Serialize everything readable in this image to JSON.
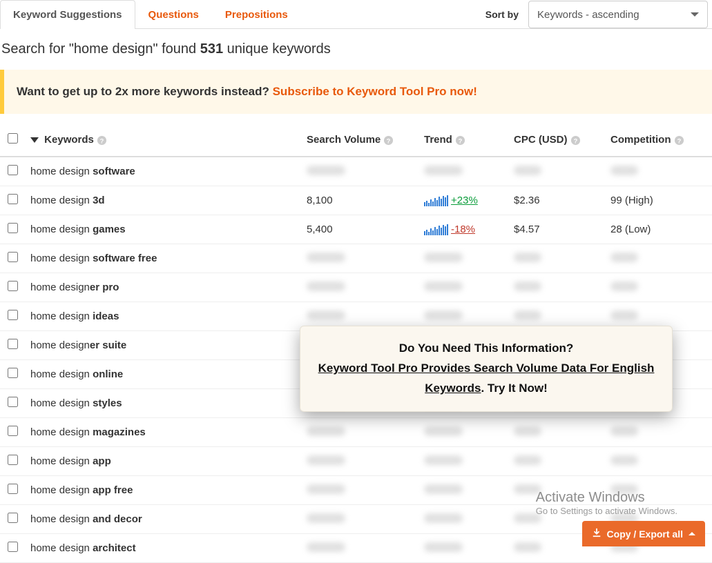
{
  "tabs": {
    "suggestions": "Keyword Suggestions",
    "questions": "Questions",
    "prepositions": "Prepositions"
  },
  "sort": {
    "label": "Sort by",
    "selected": "Keywords - ascending"
  },
  "summary": {
    "prefix": "Search for \"home design\" found ",
    "count": "531",
    "suffix": " unique keywords"
  },
  "promo": {
    "text": "Want to get up to 2x more keywords instead? ",
    "link": "Subscribe to Keyword Tool Pro now!"
  },
  "columns": {
    "keywords": "Keywords",
    "volume": "Search Volume",
    "trend": "Trend",
    "cpc": "CPC (USD)",
    "competition": "Competition"
  },
  "rows": [
    {
      "prefix": "home design ",
      "bold": "software",
      "blurred": true
    },
    {
      "prefix": "home design ",
      "bold": "3d",
      "volume": "8,100",
      "trend": "+23%",
      "trend_dir": "up",
      "cpc": "$2.36",
      "competition": "99 (High)"
    },
    {
      "prefix": "home design ",
      "bold": "games",
      "volume": "5,400",
      "trend": "-18%",
      "trend_dir": "down",
      "cpc": "$4.57",
      "competition": "28 (Low)"
    },
    {
      "prefix": "home design ",
      "bold": "software free",
      "blurred": true
    },
    {
      "prefix": "home design",
      "bold": "er pro",
      "blurred": true
    },
    {
      "prefix": "home design ",
      "bold": "ideas",
      "blurred": true
    },
    {
      "prefix": "home design",
      "bold": "er suite",
      "blurred": true
    },
    {
      "prefix": "home design ",
      "bold": "online",
      "blurred": true
    },
    {
      "prefix": "home design ",
      "bold": "styles",
      "blurred": true
    },
    {
      "prefix": "home design ",
      "bold": "magazines",
      "blurred": true
    },
    {
      "prefix": "home design ",
      "bold": "app",
      "blurred": true
    },
    {
      "prefix": "home design ",
      "bold": "app free",
      "blurred": true
    },
    {
      "prefix": "home design ",
      "bold": "and decor",
      "blurred": true
    },
    {
      "prefix": "home design ",
      "bold": "architect",
      "blurred": true
    }
  ],
  "overlay": {
    "line1": "Do You Need This Information?",
    "link": "Keyword Tool Pro Provides Search Volume Data For English Keywords",
    "tail": ". Try It Now!"
  },
  "export": {
    "label": "Copy / Export all"
  },
  "watermark": {
    "line1": "Activate Windows",
    "line2": "Go to Settings to activate Windows."
  }
}
